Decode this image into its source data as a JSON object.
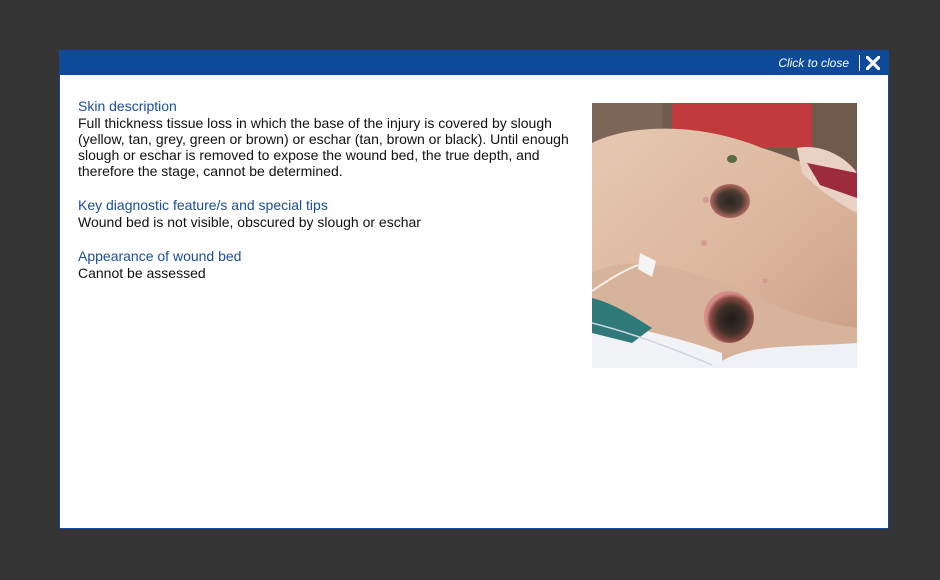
{
  "header": {
    "close_label": "Click to close",
    "close_icon": "close-x-icon",
    "bar_color": "#0d4a99"
  },
  "sections": [
    {
      "title": "Skin description",
      "body": "Full thickness tissue loss in which the base of the injury is covered by slough (yellow, tan, grey, green or brown) or eschar (tan, brown or black). Until enough slough or eschar is removed to expose the wound bed, the true depth, and therefore the stage, cannot be determined."
    },
    {
      "title": "Key diagnostic feature/s and special tips",
      "body": "Wound bed is not visible, obscured by slough or eschar"
    },
    {
      "title": "Appearance of wound bed",
      "body": "Cannot be assessed"
    }
  ],
  "colors": {
    "backdrop": "#353535",
    "heading": "#1a4d9c",
    "text": "#111111"
  }
}
